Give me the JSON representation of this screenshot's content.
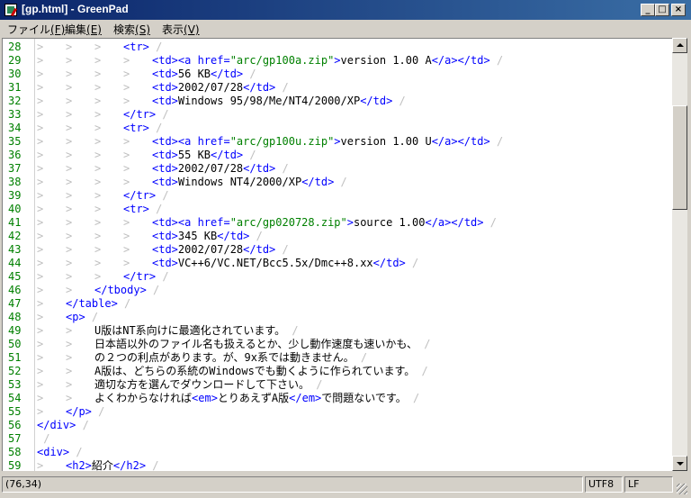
{
  "window": {
    "title": "[gp.html] - GreenPad"
  },
  "caption_buttons": {
    "minimize": "_",
    "maximize": "□",
    "close": "×"
  },
  "menu": [
    {
      "label": "ファイル",
      "accel": "(F)"
    },
    {
      "label": "編集",
      "accel": "(E)"
    },
    {
      "label": "検索",
      "accel": "(S)"
    },
    {
      "label": "表示",
      "accel": "(V)"
    }
  ],
  "editor": {
    "lines": [
      {
        "num": "28",
        "indent": 3,
        "parts": [
          [
            "tag",
            "<tr>"
          ]
        ]
      },
      {
        "num": "29",
        "indent": 4,
        "parts": [
          [
            "tag",
            "<td><a href="
          ],
          [
            "str",
            "\"arc/gp100a.zip\""
          ],
          [
            "tag",
            ">"
          ],
          [
            "txt",
            "version 1.00 A"
          ],
          [
            "tag",
            "</a></td>"
          ]
        ]
      },
      {
        "num": "30",
        "indent": 4,
        "parts": [
          [
            "tag",
            "<td>"
          ],
          [
            "txt",
            "56 KB"
          ],
          [
            "tag",
            "</td>"
          ]
        ]
      },
      {
        "num": "31",
        "indent": 4,
        "parts": [
          [
            "tag",
            "<td>"
          ],
          [
            "txt",
            "2002/07/28"
          ],
          [
            "tag",
            "</td>"
          ]
        ]
      },
      {
        "num": "32",
        "indent": 4,
        "parts": [
          [
            "tag",
            "<td>"
          ],
          [
            "txt",
            "Windows 95/98/Me/NT4/2000/XP"
          ],
          [
            "tag",
            "</td>"
          ]
        ]
      },
      {
        "num": "33",
        "indent": 3,
        "parts": [
          [
            "tag",
            "</tr>"
          ]
        ]
      },
      {
        "num": "34",
        "indent": 3,
        "parts": [
          [
            "tag",
            "<tr>"
          ]
        ]
      },
      {
        "num": "35",
        "indent": 4,
        "parts": [
          [
            "tag",
            "<td><a href="
          ],
          [
            "str",
            "\"arc/gp100u.zip\""
          ],
          [
            "tag",
            ">"
          ],
          [
            "txt",
            "version 1.00 U"
          ],
          [
            "tag",
            "</a></td>"
          ]
        ]
      },
      {
        "num": "36",
        "indent": 4,
        "parts": [
          [
            "tag",
            "<td>"
          ],
          [
            "txt",
            "55 KB"
          ],
          [
            "tag",
            "</td>"
          ]
        ]
      },
      {
        "num": "37",
        "indent": 4,
        "parts": [
          [
            "tag",
            "<td>"
          ],
          [
            "txt",
            "2002/07/28"
          ],
          [
            "tag",
            "</td>"
          ]
        ]
      },
      {
        "num": "38",
        "indent": 4,
        "parts": [
          [
            "tag",
            "<td>"
          ],
          [
            "txt",
            "Windows NT4/2000/XP"
          ],
          [
            "tag",
            "</td>"
          ]
        ]
      },
      {
        "num": "39",
        "indent": 3,
        "parts": [
          [
            "tag",
            "</tr>"
          ]
        ]
      },
      {
        "num": "40",
        "indent": 3,
        "parts": [
          [
            "tag",
            "<tr>"
          ]
        ]
      },
      {
        "num": "41",
        "indent": 4,
        "parts": [
          [
            "tag",
            "<td><a href="
          ],
          [
            "str",
            "\"arc/gp020728.zip\""
          ],
          [
            "tag",
            ">"
          ],
          [
            "txt",
            "source 1.00"
          ],
          [
            "tag",
            "</a></td>"
          ]
        ]
      },
      {
        "num": "42",
        "indent": 4,
        "parts": [
          [
            "tag",
            "<td>"
          ],
          [
            "txt",
            "345 KB"
          ],
          [
            "tag",
            "</td>"
          ]
        ]
      },
      {
        "num": "43",
        "indent": 4,
        "parts": [
          [
            "tag",
            "<td>"
          ],
          [
            "txt",
            "2002/07/28"
          ],
          [
            "tag",
            "</td>"
          ]
        ]
      },
      {
        "num": "44",
        "indent": 4,
        "parts": [
          [
            "tag",
            "<td>"
          ],
          [
            "txt",
            "VC++6/VC.NET/Bcc5.5x/Dmc++8.xx"
          ],
          [
            "tag",
            "</td>"
          ]
        ]
      },
      {
        "num": "45",
        "indent": 3,
        "parts": [
          [
            "tag",
            "</tr>"
          ]
        ]
      },
      {
        "num": "46",
        "indent": 2,
        "parts": [
          [
            "tag",
            "</tbody>"
          ]
        ]
      },
      {
        "num": "47",
        "indent": 1,
        "parts": [
          [
            "tag",
            "</table>"
          ]
        ]
      },
      {
        "num": "48",
        "indent": 1,
        "parts": [
          [
            "tag",
            "<p>"
          ]
        ]
      },
      {
        "num": "49",
        "indent": 2,
        "parts": [
          [
            "txt",
            "U版はNT系向けに最適化されています。"
          ]
        ]
      },
      {
        "num": "50",
        "indent": 2,
        "parts": [
          [
            "txt",
            "日本語以外のファイル名も扱えるとか、少し動作速度も速いかも、"
          ]
        ]
      },
      {
        "num": "51",
        "indent": 2,
        "parts": [
          [
            "txt",
            "の２つの利点があります。が、9x系では動きません。"
          ]
        ]
      },
      {
        "num": "52",
        "indent": 2,
        "parts": [
          [
            "txt",
            "A版は、どちらの系統のWindowsでも動くように作られています。"
          ]
        ]
      },
      {
        "num": "53",
        "indent": 2,
        "parts": [
          [
            "txt",
            "適切な方を選んでダウンロードして下さい。"
          ]
        ]
      },
      {
        "num": "54",
        "indent": 2,
        "parts": [
          [
            "txt",
            "よくわからなければ"
          ],
          [
            "tag",
            "<em>"
          ],
          [
            "txt",
            "とりあえずA版"
          ],
          [
            "tag",
            "</em>"
          ],
          [
            "txt",
            "で問題ないです。"
          ]
        ]
      },
      {
        "num": "55",
        "indent": 1,
        "parts": [
          [
            "tag",
            "</p>"
          ]
        ]
      },
      {
        "num": "56",
        "indent": 0,
        "parts": [
          [
            "tag",
            "</div>"
          ]
        ]
      },
      {
        "num": "57",
        "indent": 0,
        "parts": []
      },
      {
        "num": "58",
        "indent": 0,
        "parts": [
          [
            "tag",
            "<div>"
          ]
        ]
      },
      {
        "num": "59",
        "indent": 1,
        "parts": [
          [
            "tag",
            "<h2>"
          ],
          [
            "txt",
            "紹介"
          ],
          [
            "tag",
            "</h2>"
          ]
        ]
      }
    ]
  },
  "scrollbar": {
    "position": 0.26,
    "visible_fraction": 0.26
  },
  "status": {
    "cursor": "(76,34)",
    "encoding": "UTF8",
    "line_ending": "LF"
  }
}
